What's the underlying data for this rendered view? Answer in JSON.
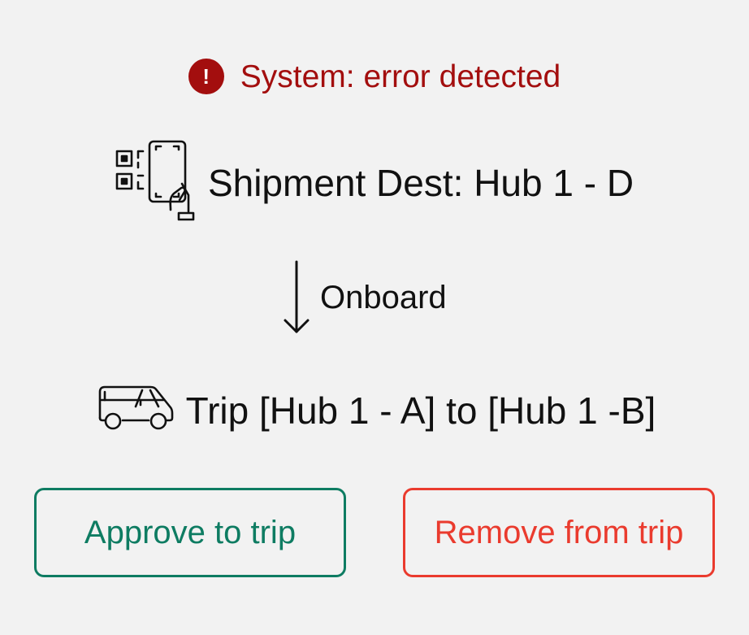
{
  "alert": {
    "icon": "exclamation-circle-icon",
    "text": "System: error detected",
    "color": "#a30e0e"
  },
  "shipment": {
    "icon": "phone-qr-scan-icon",
    "text": "Shipment Dest: Hub 1 - D"
  },
  "flow": {
    "icon": "arrow-down-icon",
    "label": "Onboard"
  },
  "trip": {
    "icon": "van-icon",
    "text": "Trip [Hub 1 - A] to [Hub 1 -B]"
  },
  "actions": {
    "approve_label": "Approve to trip",
    "approve_color": "#0e7c62",
    "remove_label": "Remove from trip",
    "remove_color": "#ea3b2e"
  }
}
